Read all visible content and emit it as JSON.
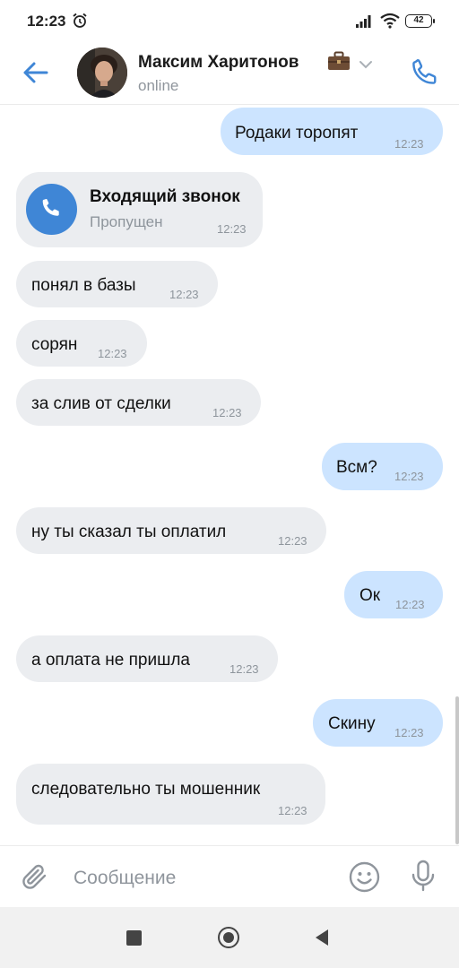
{
  "status_bar": {
    "time": "12:23",
    "battery": "42"
  },
  "header": {
    "name": "Максим Харитонов",
    "status": "online"
  },
  "messages": [
    {
      "dir": "out",
      "text": "Родаки торопят",
      "time": "12:23"
    },
    {
      "dir": "in",
      "type": "call",
      "title": "Входящий звонок",
      "subtitle": "Пропущен",
      "time": "12:23"
    },
    {
      "dir": "in",
      "text": "понял в базы",
      "time": "12:23"
    },
    {
      "dir": "in",
      "text": "сорян",
      "time": "12:23"
    },
    {
      "dir": "in",
      "text": "за слив от сделки",
      "time": "12:23"
    },
    {
      "dir": "out",
      "text": "Всм?",
      "time": "12:23"
    },
    {
      "dir": "in",
      "text": "ну ты сказал ты оплатил",
      "time": "12:23"
    },
    {
      "dir": "out",
      "text": "Ок",
      "time": "12:23"
    },
    {
      "dir": "in",
      "text": "а оплата не пришла",
      "time": "12:23"
    },
    {
      "dir": "out",
      "text": "Скину",
      "time": "12:23"
    },
    {
      "dir": "in",
      "text": "следовательно ты мошенник",
      "time": "12:23"
    }
  ],
  "composer": {
    "placeholder": "Сообщение"
  },
  "colors": {
    "accent": "#3f86d6",
    "incoming_bubble": "#ebedf0",
    "outgoing_bubble": "#cce4ff"
  }
}
